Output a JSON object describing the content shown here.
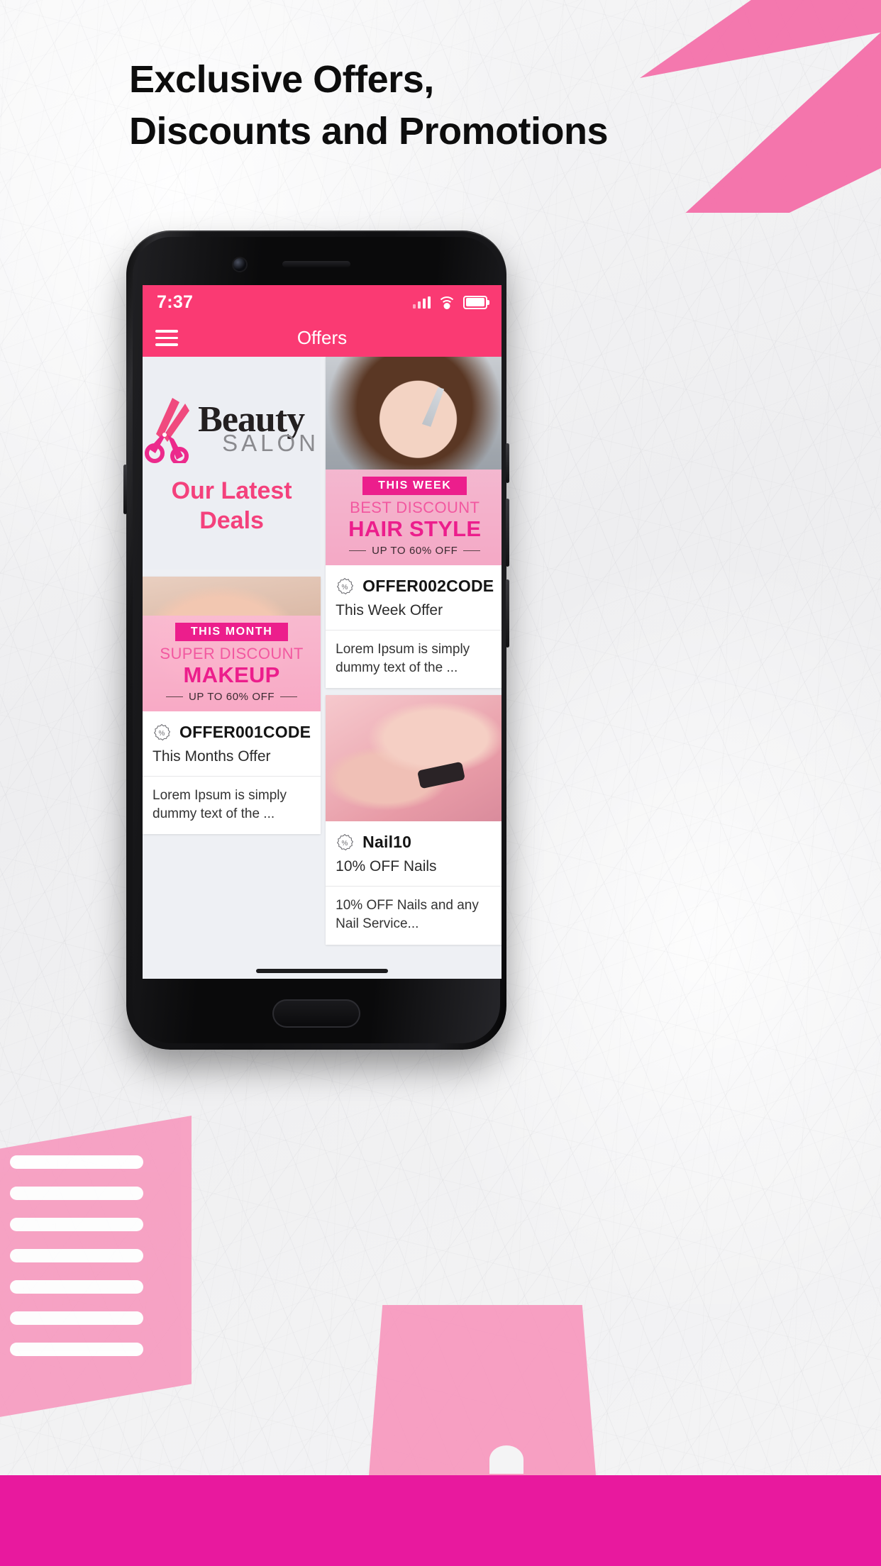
{
  "poster": {
    "headline_line1": "Exclusive Offers,",
    "headline_line2": "Discounts and Promotions",
    "accent_pink": "#F46AA6",
    "bottom_bar_color": "#E8199E"
  },
  "phone": {
    "status_bar": {
      "time": "7:37",
      "signal_icon": "signal-bars-icon",
      "wifi_icon": "wifi-icon",
      "battery_icon": "battery-icon",
      "background_color": "#FA3A73"
    },
    "app_bar": {
      "menu_icon": "hamburger-menu-icon",
      "title": "Offers",
      "background_color": "#FA3A73"
    }
  },
  "latest_tile": {
    "logo_primary": "Beauty",
    "logo_secondary": "SALON",
    "logo_icon": "scissors-icon",
    "heading_line1": "Our Latest",
    "heading_line2": "Deals",
    "heading_color": "#F4417C"
  },
  "offers": [
    {
      "id": "hair-style",
      "banner": {
        "tag": "THIS WEEK",
        "subtitle": "BEST DISCOUNT",
        "title": "HAIR STYLE",
        "footer": "UP TO 60% OFF"
      },
      "code_icon": "percent-badge-icon",
      "code": "OFFER002CODE",
      "subtitle": "This Week Offer",
      "description": "Lorem Ipsum is simply dummy text of the ..."
    },
    {
      "id": "makeup",
      "banner": {
        "tag": "THIS MONTH",
        "subtitle": "SUPER DISCOUNT",
        "title": "MAKEUP",
        "footer": "UP TO 60% OFF"
      },
      "code_icon": "percent-badge-icon",
      "code": "OFFER001CODE",
      "subtitle": "This Months Offer",
      "description": "Lorem Ipsum is simply dummy text of the ..."
    },
    {
      "id": "nails",
      "banner": null,
      "code_icon": "percent-badge-icon",
      "code": "Nail10",
      "subtitle": "10% OFF Nails",
      "description": "10% OFF Nails and any Nail Service..."
    }
  ]
}
